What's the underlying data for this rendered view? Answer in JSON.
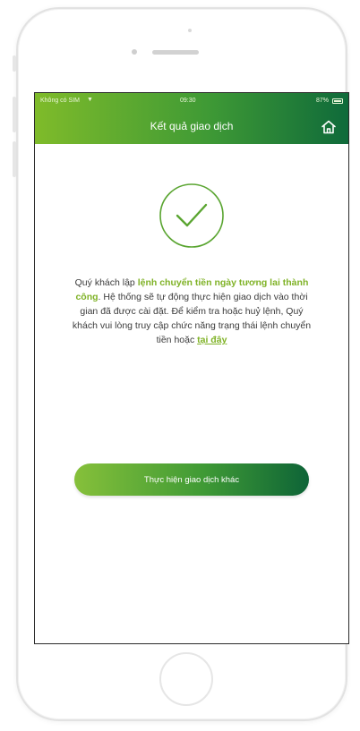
{
  "status_bar": {
    "carrier": "Không có SIM",
    "time": "09:30",
    "battery": "87%"
  },
  "header": {
    "title": "Kết quả giao dịch",
    "home_icon": "home-icon"
  },
  "result": {
    "icon": "check-circle-icon",
    "accent_color": "#7fb226",
    "message_part1": "Quý khách lập ",
    "message_highlight": "lệnh chuyển tiền ngày tương lai thành công",
    "message_part2": ". Hệ thống sẽ tự động thực hiện giao dịch vào thời gian đã được cài đặt. Để kiểm tra hoặc huỷ lệnh, Quý khách vui lòng truy cập chức năng trạng thái lệnh chuyển tiền hoặc ",
    "message_link": "tại đây"
  },
  "actions": {
    "primary_label": "Thực hiện giao dịch khác"
  },
  "colors": {
    "gradient_start": "#7fbb2a",
    "gradient_end": "#0f6a3a"
  }
}
